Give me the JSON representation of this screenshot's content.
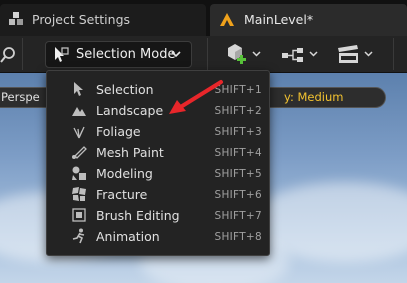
{
  "tabs": {
    "project_settings": "Project Settings",
    "main_level": "MainLevel*"
  },
  "toolbar": {
    "mode_button_label": "Selection Mode"
  },
  "viewport": {
    "perspective_pill": "Perspe",
    "quality_pill": "y: Medium"
  },
  "menu": {
    "items": [
      {
        "label": "Selection",
        "shortcut": "SHIFT+1",
        "icon": "selection-icon"
      },
      {
        "label": "Landscape",
        "shortcut": "SHIFT+2",
        "icon": "landscape-icon"
      },
      {
        "label": "Foliage",
        "shortcut": "SHIFT+3",
        "icon": "foliage-icon"
      },
      {
        "label": "Mesh Paint",
        "shortcut": "SHIFT+4",
        "icon": "mesh-paint-icon"
      },
      {
        "label": "Modeling",
        "shortcut": "SHIFT+5",
        "icon": "modeling-icon"
      },
      {
        "label": "Fracture",
        "shortcut": "SHIFT+6",
        "icon": "fracture-icon"
      },
      {
        "label": "Brush Editing",
        "shortcut": "SHIFT+7",
        "icon": "brush-editing-icon"
      },
      {
        "label": "Animation",
        "shortcut": "SHIFT+8",
        "icon": "animation-icon"
      }
    ]
  },
  "colors": {
    "accent_arrow": "#e8262a",
    "level_icon": "#f0a21c",
    "quality_text": "#f2c230",
    "add_icon": "#58c23a"
  }
}
